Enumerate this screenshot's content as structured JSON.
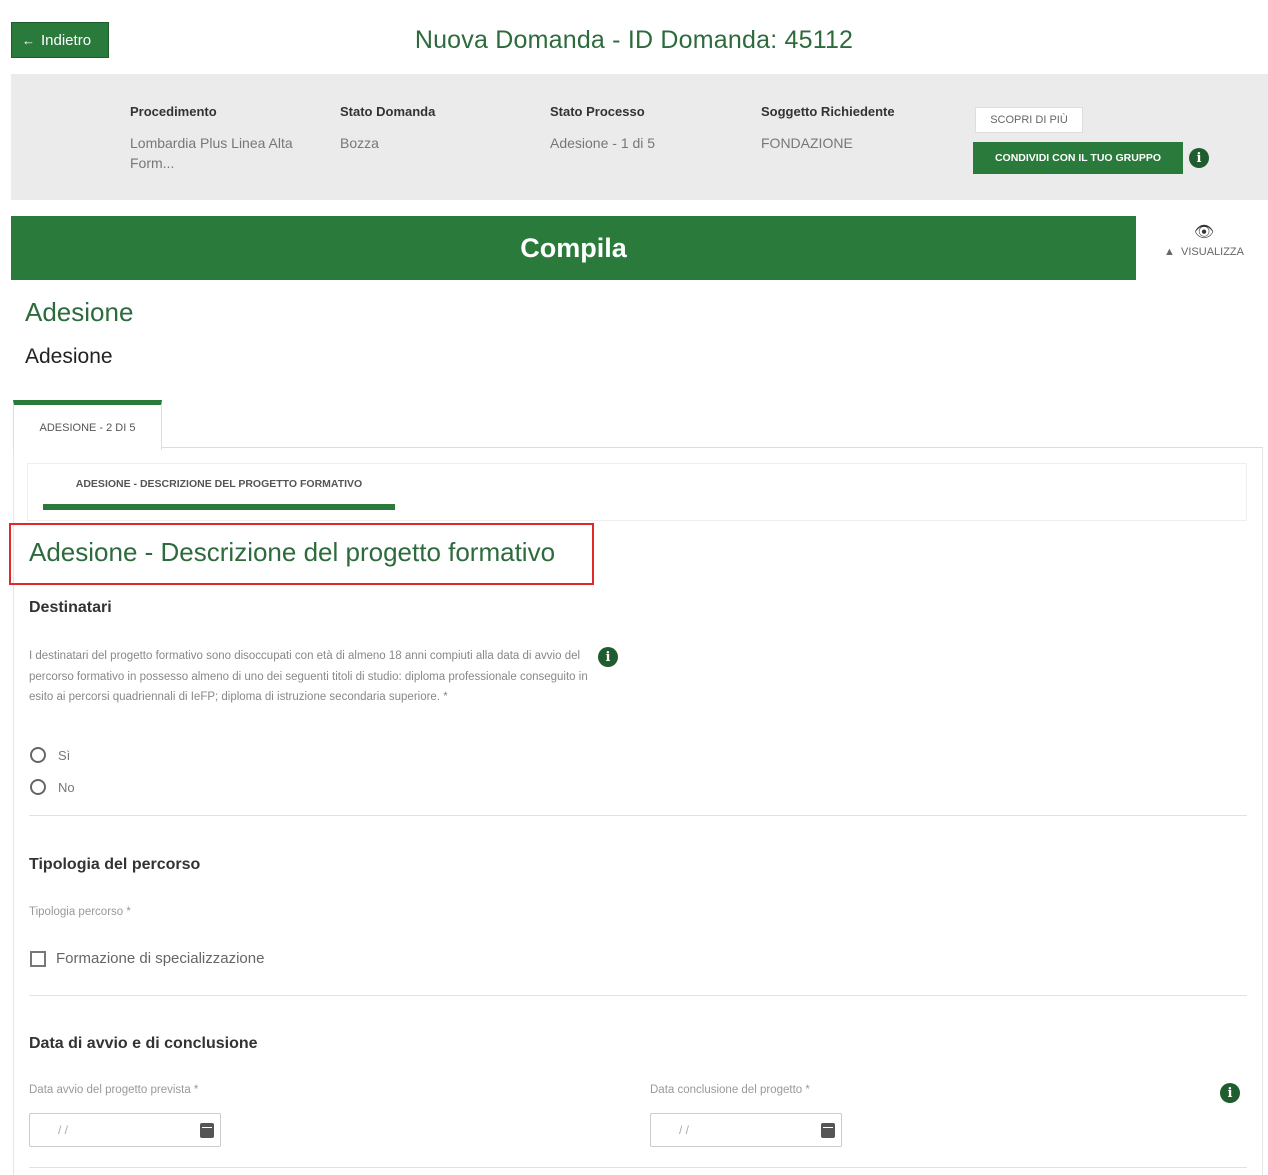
{
  "header": {
    "back_label": "Indietro",
    "title": "Nuova Domanda - ID Domanda: 45112"
  },
  "info": {
    "procedimento_label": "Procedimento",
    "procedimento_value": "Lombardia Plus Linea Alta Form...",
    "stato_domanda_label": "Stato Domanda",
    "stato_domanda_value": "Bozza",
    "stato_processo_label": "Stato Processo",
    "stato_processo_value": "Adesione - 1 di 5",
    "soggetto_label": "Soggetto Richiedente",
    "soggetto_value": "FONDAZIONE",
    "scopri_label": "SCOPRI DI PIÙ",
    "condividi_label": "CONDIVIDI CON IL TUO GRUPPO"
  },
  "compila": {
    "label": "Compila",
    "visualizza_label": "VISUALIZZA"
  },
  "section": {
    "title": "Adesione",
    "subtitle": "Adesione",
    "tab_label": "ADESIONE - 2 DI 5",
    "subtab_label": "ADESIONE - DESCRIZIONE DEL PROGETTO FORMATIVO"
  },
  "form": {
    "title": "Adesione - Descrizione del progetto formativo",
    "destinatari": {
      "title": "Destinatari",
      "description": "I destinatari del progetto formativo sono disoccupati con età di almeno 18 anni compiuti alla data di avvio del percorso formativo in possesso almeno di uno dei seguenti titoli di studio: diploma professionale conseguito in esito ai percorsi quadriennali di IeFP; diploma di istruzione secondaria superiore. *",
      "option_yes": "Sì",
      "option_no": "No"
    },
    "tipologia": {
      "title": "Tipologia del percorso",
      "field_label": "Tipologia percorso *",
      "checkbox_label": "Formazione di specializzazione"
    },
    "date": {
      "title": "Data di avvio e di conclusione",
      "start_label": "Data avvio del progetto prevista *",
      "end_label": "Data conclusione del progetto *",
      "date_placeholder": "/ /"
    }
  },
  "colors": {
    "primary_green": "#2a7a3b",
    "title_green": "#2d6b3d",
    "highlight_red": "#e0292b"
  }
}
